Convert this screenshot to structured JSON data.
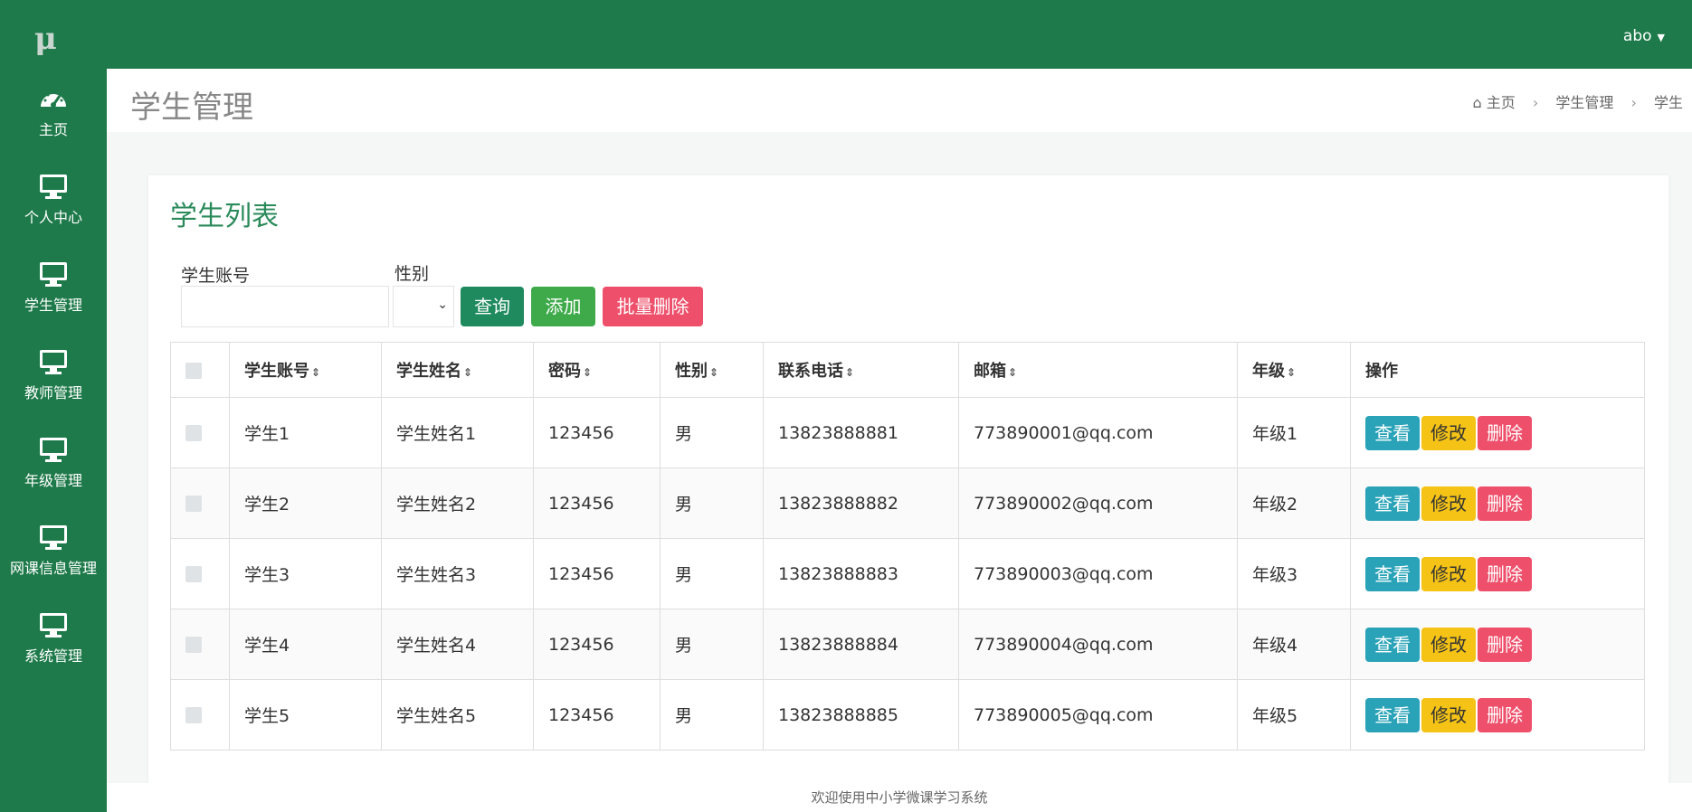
{
  "app": {
    "logo": "μ",
    "user": "abo"
  },
  "sidebar": {
    "items": [
      {
        "label": "主页",
        "icon": "dashboard-icon"
      },
      {
        "label": "个人中心",
        "icon": "monitor-icon"
      },
      {
        "label": "学生管理",
        "icon": "monitor-icon"
      },
      {
        "label": "教师管理",
        "icon": "monitor-icon"
      },
      {
        "label": "年级管理",
        "icon": "monitor-icon"
      },
      {
        "label": "网课信息管理",
        "icon": "monitor-icon"
      },
      {
        "label": "系统管理",
        "icon": "monitor-icon"
      }
    ]
  },
  "header": {
    "title": "学生管理",
    "breadcrumb": [
      "主页",
      "学生管理",
      "学生"
    ]
  },
  "card": {
    "title": "学生列表"
  },
  "search": {
    "account_label": "学生账号",
    "account_value": "",
    "gender_label": "性别",
    "gender_value": "",
    "query_button": "查询",
    "add_button": "添加",
    "batch_delete_button": "批量删除"
  },
  "table": {
    "columns": [
      "学生账号",
      "学生姓名",
      "密码",
      "性别",
      "联系电话",
      "邮箱",
      "年级",
      "操作"
    ],
    "rows": [
      {
        "account": "学生1",
        "name": "学生姓名1",
        "password": "123456",
        "gender": "男",
        "phone": "13823888881",
        "email": "773890001@qq.com",
        "grade": "年级1"
      },
      {
        "account": "学生2",
        "name": "学生姓名2",
        "password": "123456",
        "gender": "男",
        "phone": "13823888882",
        "email": "773890002@qq.com",
        "grade": "年级2"
      },
      {
        "account": "学生3",
        "name": "学生姓名3",
        "password": "123456",
        "gender": "男",
        "phone": "13823888883",
        "email": "773890003@qq.com",
        "grade": "年级3"
      },
      {
        "account": "学生4",
        "name": "学生姓名4",
        "password": "123456",
        "gender": "男",
        "phone": "13823888884",
        "email": "773890004@qq.com",
        "grade": "年级4"
      },
      {
        "account": "学生5",
        "name": "学生姓名5",
        "password": "123456",
        "gender": "男",
        "phone": "13823888885",
        "email": "773890005@qq.com",
        "grade": "年级5"
      }
    ],
    "actions": {
      "view": "查看",
      "edit": "修改",
      "delete": "删除"
    }
  },
  "footer": {
    "text": "欢迎使用中小学微课学习系统"
  },
  "colors": {
    "brand": "#1e7a4a",
    "view": "#2aa3b8",
    "edit": "#f5c316",
    "delete": "#ee4f6a",
    "add": "#3eaa4a",
    "query": "#1e8a5e",
    "batch_delete": "#ee4f6a"
  }
}
